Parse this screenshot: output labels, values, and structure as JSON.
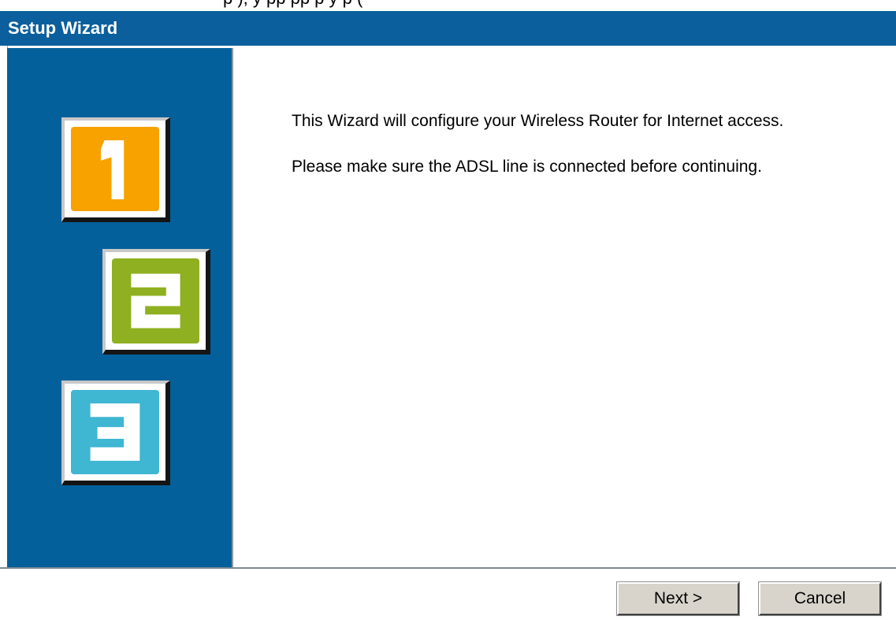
{
  "top_fragment_text": "p                ), y              pp                                                 pp                               p                 y   p  (",
  "window": {
    "title": "Setup Wizard"
  },
  "steps": [
    {
      "label": "1",
      "color": "#f8a200"
    },
    {
      "label": "2",
      "color": "#8fb020"
    },
    {
      "label": "3",
      "color": "#3fb6d2"
    }
  ],
  "content": {
    "line1": "This Wizard will configure your Wireless Router for Internet access.",
    "line2": "Please make sure the ADSL line is connected before continuing."
  },
  "buttons": {
    "next_label": "Next >",
    "cancel_label": "Cancel"
  },
  "colors": {
    "title_bar": "#0a5f9c",
    "panel": "#03609a",
    "button_face": "#d8d4cc"
  }
}
